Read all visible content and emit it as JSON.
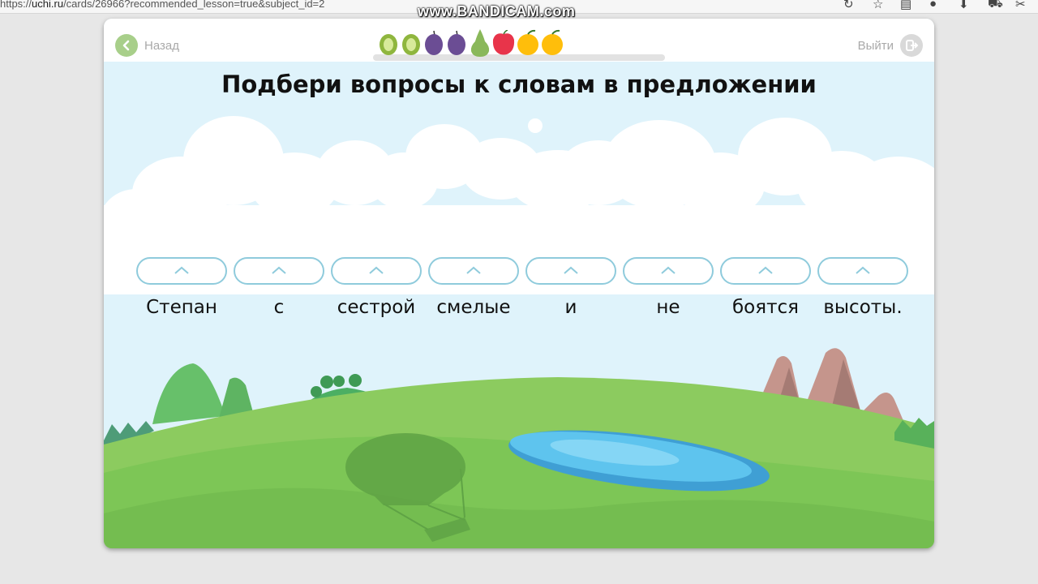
{
  "browser": {
    "url_prefix": "https://",
    "url_host": "uchi.ru",
    "url_path": "/cards/26966?recommended_lesson=true&subject_id=2"
  },
  "watermark": "www.BANDICAM.com",
  "header": {
    "back_label": "Назад",
    "exit_label": "Выйти"
  },
  "progress": {
    "fruits": [
      "kiwi-icon",
      "kiwi-icon",
      "plum-icon",
      "plum-icon",
      "pear-icon",
      "apple-icon",
      "orange-icon",
      "orange-icon"
    ]
  },
  "task": {
    "title": "Подбери вопросы к словам в предложении"
  },
  "words": [
    "Степан",
    "с",
    "сестрой",
    "смелые",
    "и",
    "не",
    "боятся",
    "высоты."
  ],
  "colors": {
    "sky": "#dff3fb",
    "grass": "#7dc656",
    "slot_border": "#8fcbdc",
    "back_button": "#a8cf8a",
    "lake": "#5ec4ee"
  }
}
